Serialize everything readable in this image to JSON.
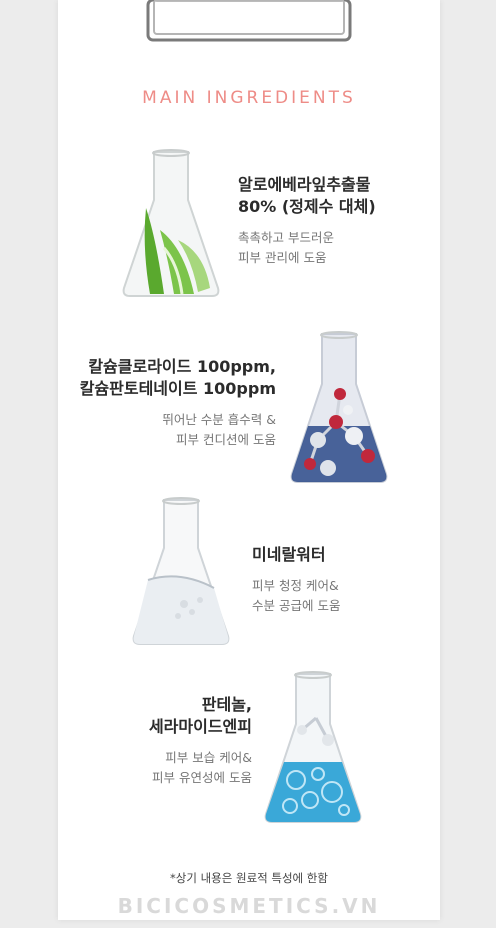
{
  "heading": "MAIN INGREDIENTS",
  "ingredients": [
    {
      "title_line1": "알로에베라잎추출물",
      "title_line2": "80% (정제수 대체)",
      "desc_line1": "촉촉하고 부드러운",
      "desc_line2": "피부 관리에 도움"
    },
    {
      "title_line1": "칼슘클로라이드 100ppm,",
      "title_line2": "칼슘판토테네이트 100ppm",
      "desc_line1": "뛰어난 수분 흡수력 &",
      "desc_line2": "피부 컨디션에 도움"
    },
    {
      "title_line1": "미네랄워터",
      "title_line2": "",
      "desc_line1": "피부 청정 케어&",
      "desc_line2": "수분 공급에 도움"
    },
    {
      "title_line1": "판테놀,",
      "title_line2": "세라마이드엔피",
      "desc_line1": "피부 보습 케어&",
      "desc_line2": "피부 유연성에 도움"
    }
  ],
  "footnote": "*상기 내용은 원료적 특성에 한함",
  "watermark": "BICICOSMETICS.VN",
  "colors": {
    "heading": "#ee8c87",
    "aloe": "#6fbf3a",
    "liquid_blue": "#3aa8d8"
  }
}
